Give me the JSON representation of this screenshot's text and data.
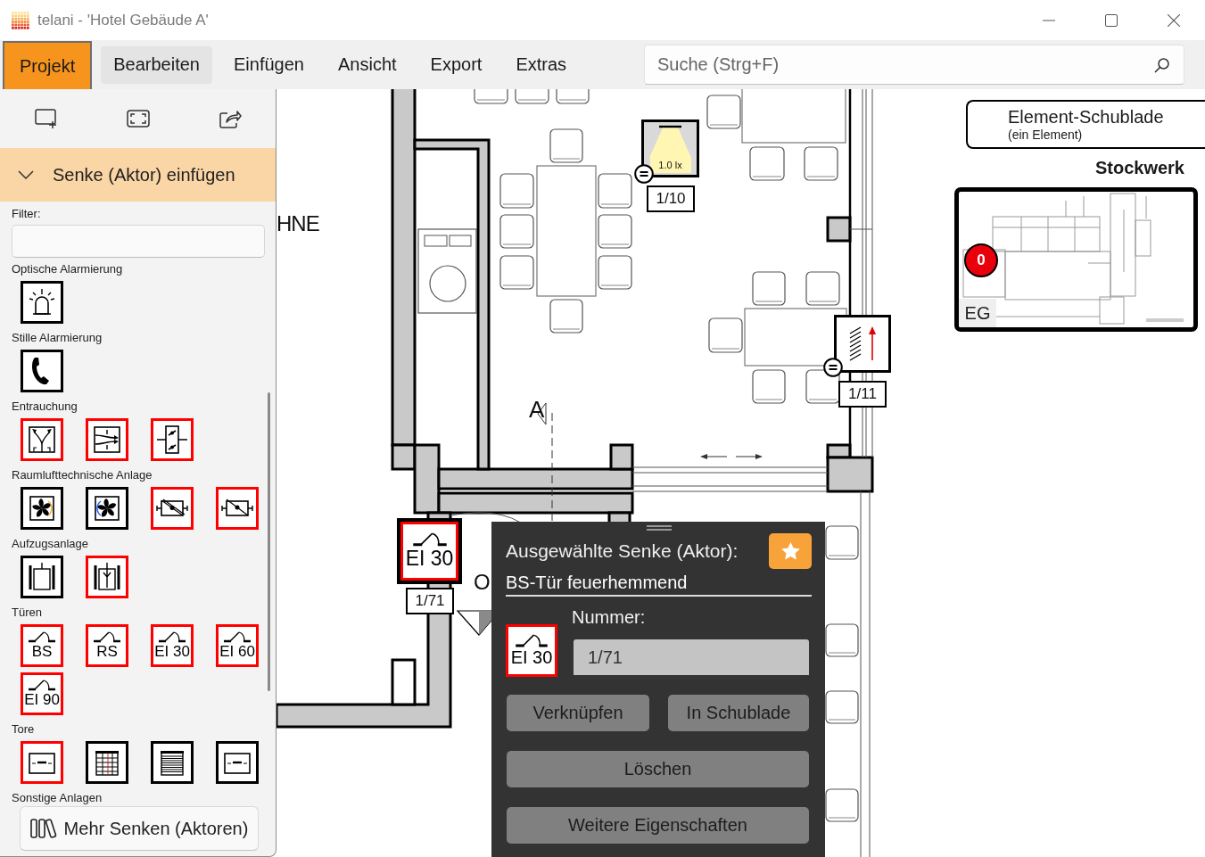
{
  "window": {
    "title": "telani - 'Hotel Gebäude A'"
  },
  "menu": [
    {
      "label": "Projekt",
      "selected": true,
      "hovered": false
    },
    {
      "label": "Bearbeiten",
      "selected": false,
      "hovered": true
    },
    {
      "label": "Einfügen",
      "selected": false,
      "hovered": false
    },
    {
      "label": "Ansicht",
      "selected": false,
      "hovered": false
    },
    {
      "label": "Export",
      "selected": false,
      "hovered": false
    },
    {
      "label": "Extras",
      "selected": false,
      "hovered": false
    }
  ],
  "search": {
    "placeholder": "Suche (Strg+F)"
  },
  "sidebar": {
    "section": {
      "title": "Senke (Aktor) einfügen",
      "expanded": true
    },
    "filter": {
      "label": "Filter:"
    },
    "groups": [
      {
        "title": "Optische Alarmierung",
        "items": [
          {
            "kind": "beacon",
            "color": "#000000"
          }
        ]
      },
      {
        "title": "Stille Alarmierung",
        "items": [
          {
            "kind": "phone",
            "color": "#000000"
          }
        ]
      },
      {
        "title": "Entrauchung",
        "items": [
          {
            "kind": "split-flow",
            "color": "#ff0000"
          },
          {
            "kind": "cross-flow",
            "color": "#ff0000"
          },
          {
            "kind": "damper",
            "color": "#ff0000"
          }
        ]
      },
      {
        "title": "Raumlufttechnische Anlage",
        "items": [
          {
            "kind": "fan-cw",
            "color": "#000000"
          },
          {
            "kind": "fan-ccw",
            "color": "#000000"
          },
          {
            "kind": "damper-box",
            "color": "#ff0000"
          },
          {
            "kind": "damper-box-alt",
            "color": "#ff0000"
          }
        ]
      },
      {
        "title": "Aufzugsanlage",
        "items": [
          {
            "kind": "elevator",
            "color": "#000000"
          },
          {
            "kind": "elevator-fan",
            "color": "#ff0000"
          }
        ]
      },
      {
        "title": "Türen",
        "items": [
          {
            "kind": "door",
            "label": "BS",
            "color": "#ff0000"
          },
          {
            "kind": "door",
            "label": "RS",
            "color": "#ff0000"
          },
          {
            "kind": "door",
            "label": "EI 30",
            "color": "#ff0000"
          },
          {
            "kind": "door",
            "label": "EI 60",
            "color": "#ff0000"
          },
          {
            "kind": "door",
            "label": "EI 90",
            "color": "#ff0000"
          }
        ]
      },
      {
        "title": "Tore",
        "items": [
          {
            "kind": "gate",
            "color": "#ff0000"
          },
          {
            "kind": "gate-grid",
            "color": "#000000"
          },
          {
            "kind": "gate-shutter",
            "color": "#000000"
          },
          {
            "kind": "gate",
            "color": "#000000"
          }
        ]
      },
      {
        "title": "Sonstige Anlagen"
      }
    ],
    "more_button": "Mehr Senken (Aktoren)"
  },
  "plan": {
    "labels": [
      "HNE",
      "A",
      "O"
    ],
    "symbols": [
      {
        "kind": "light",
        "reading": "1.0 lx",
        "number": "1/10",
        "color": "#000000",
        "equals_badge": true,
        "selected": false
      },
      {
        "kind": "window",
        "number": "1/11",
        "color": "#000000",
        "equals_badge": true,
        "selected": false
      },
      {
        "kind": "door",
        "label": "EI 30",
        "number": "1/71",
        "color": "#ff0000",
        "equals_badge": false,
        "selected": true
      }
    ]
  },
  "drawer": {
    "title": "Element-Schublade",
    "subtitle": "(ein Element)"
  },
  "floor": {
    "heading": "Stockwerk",
    "badge": "0",
    "name": "EG"
  },
  "inspector": {
    "title": "Ausgewählte Senke (Aktor):",
    "name": "BS-Tür feuerhemmend",
    "number_label": "Nummer:",
    "number": "1/71",
    "symbol": {
      "kind": "door",
      "label": "EI 30",
      "color": "#ff0000"
    },
    "buttons": [
      "Verknüpfen",
      "In Schublade",
      "Löschen",
      "Weitere Eigenschaften"
    ]
  }
}
